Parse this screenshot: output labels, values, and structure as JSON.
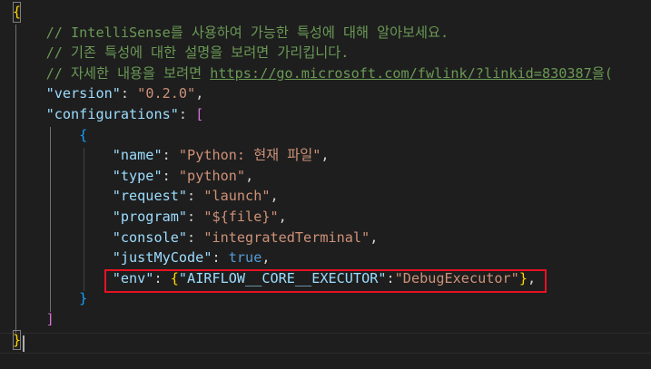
{
  "editor": {
    "lines": [
      {
        "segments": [
          {
            "t": "{",
            "c": "b1"
          }
        ]
      },
      {
        "segments": [
          {
            "t": "    ",
            "c": "c-punc"
          },
          {
            "t": "// IntelliSense를 사용하여 가능한 특성에 대해 알아보세요.",
            "c": "c-comment"
          }
        ]
      },
      {
        "segments": [
          {
            "t": "    ",
            "c": "c-punc"
          },
          {
            "t": "// 기존 특성에 대한 설명을 보려면 가리킵니다.",
            "c": "c-comment"
          }
        ]
      },
      {
        "segments": [
          {
            "t": "    ",
            "c": "c-punc"
          },
          {
            "t": "// 자세한 내용을 보려면 ",
            "c": "c-comment"
          },
          {
            "t": "https://go.microsoft.com/fwlink/?linkid=830387",
            "c": "c-link"
          },
          {
            "t": "을(",
            "c": "c-comment"
          }
        ]
      },
      {
        "segments": [
          {
            "t": "    ",
            "c": "c-punc"
          },
          {
            "t": "\"version\"",
            "c": "c-key"
          },
          {
            "t": ": ",
            "c": "c-punc"
          },
          {
            "t": "\"0.2.0\"",
            "c": "c-str"
          },
          {
            "t": ",",
            "c": "c-punc"
          }
        ]
      },
      {
        "segments": [
          {
            "t": "    ",
            "c": "c-punc"
          },
          {
            "t": "\"configurations\"",
            "c": "c-key"
          },
          {
            "t": ": ",
            "c": "c-punc"
          },
          {
            "t": "[",
            "c": "b2"
          }
        ]
      },
      {
        "segments": [
          {
            "t": "        ",
            "c": "c-punc"
          },
          {
            "t": "{",
            "c": "b3"
          }
        ]
      },
      {
        "segments": [
          {
            "t": "            ",
            "c": "c-punc"
          },
          {
            "t": "\"name\"",
            "c": "c-key"
          },
          {
            "t": ": ",
            "c": "c-punc"
          },
          {
            "t": "\"Python: 현재 파일\"",
            "c": "c-str"
          },
          {
            "t": ",",
            "c": "c-punc"
          }
        ]
      },
      {
        "segments": [
          {
            "t": "            ",
            "c": "c-punc"
          },
          {
            "t": "\"type\"",
            "c": "c-key"
          },
          {
            "t": ": ",
            "c": "c-punc"
          },
          {
            "t": "\"python\"",
            "c": "c-str"
          },
          {
            "t": ",",
            "c": "c-punc"
          }
        ]
      },
      {
        "segments": [
          {
            "t": "            ",
            "c": "c-punc"
          },
          {
            "t": "\"request\"",
            "c": "c-key"
          },
          {
            "t": ": ",
            "c": "c-punc"
          },
          {
            "t": "\"launch\"",
            "c": "c-str"
          },
          {
            "t": ",",
            "c": "c-punc"
          }
        ]
      },
      {
        "segments": [
          {
            "t": "            ",
            "c": "c-punc"
          },
          {
            "t": "\"program\"",
            "c": "c-key"
          },
          {
            "t": ": ",
            "c": "c-punc"
          },
          {
            "t": "\"${file}\"",
            "c": "c-str"
          },
          {
            "t": ",",
            "c": "c-punc"
          }
        ]
      },
      {
        "segments": [
          {
            "t": "            ",
            "c": "c-punc"
          },
          {
            "t": "\"console\"",
            "c": "c-key"
          },
          {
            "t": ": ",
            "c": "c-punc"
          },
          {
            "t": "\"integratedTerminal\"",
            "c": "c-str"
          },
          {
            "t": ",",
            "c": "c-punc"
          }
        ]
      },
      {
        "segments": [
          {
            "t": "            ",
            "c": "c-punc"
          },
          {
            "t": "\"justMyCode\"",
            "c": "c-key"
          },
          {
            "t": ": ",
            "c": "c-punc"
          },
          {
            "t": "true",
            "c": "c-bool"
          },
          {
            "t": ",",
            "c": "c-punc"
          }
        ]
      },
      {
        "segments": [
          {
            "t": "            ",
            "c": "c-punc"
          },
          {
            "t": "\"env\"",
            "c": "c-key"
          },
          {
            "t": ": ",
            "c": "c-punc"
          },
          {
            "t": "{",
            "c": "b1"
          },
          {
            "t": "\"AIRFLOW__CORE__EXECUTOR\"",
            "c": "c-key"
          },
          {
            "t": ":",
            "c": "c-punc"
          },
          {
            "t": "\"DebugExecutor\"",
            "c": "c-str"
          },
          {
            "t": "}",
            "c": "b1"
          },
          {
            "t": ",",
            "c": "c-punc"
          }
        ]
      },
      {
        "segments": [
          {
            "t": "        ",
            "c": "c-punc"
          },
          {
            "t": "}",
            "c": "b3"
          }
        ]
      },
      {
        "segments": [
          {
            "t": "    ",
            "c": "c-punc"
          },
          {
            "t": "]",
            "c": "b2"
          }
        ]
      },
      {
        "segments": [
          {
            "t": "}",
            "c": "b1"
          }
        ]
      }
    ]
  },
  "colors": {
    "background": "#1e1e1e",
    "comment": "#6a9955",
    "key": "#9cdcfe",
    "string": "#ce9178",
    "boolean": "#569cd6",
    "bracket_level1": "#ffd700",
    "bracket_level2": "#da70d6",
    "bracket_level3": "#179fff",
    "highlight_border": "#e81123"
  }
}
